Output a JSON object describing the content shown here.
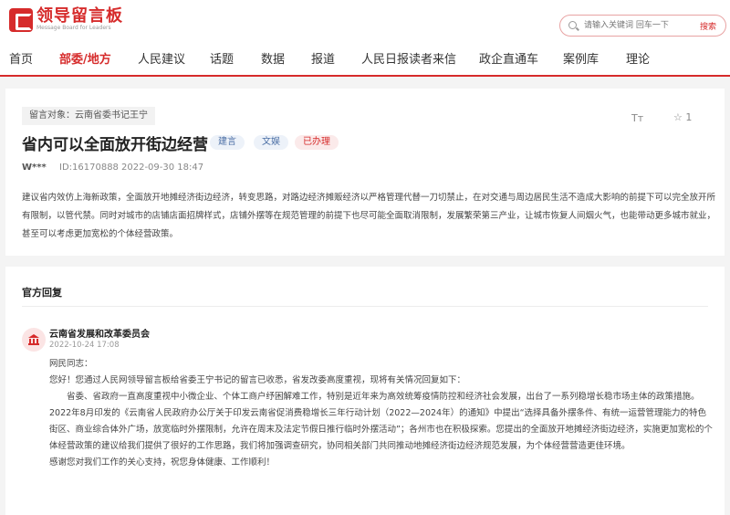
{
  "header": {
    "logo_title": "领导留言板",
    "logo_sub": "Message Board for Leaders",
    "search_placeholder": "请输入关键词 回车一下",
    "search_button": "搜索"
  },
  "nav": {
    "items": [
      "首页",
      "部委/地方",
      "人民建议",
      "话题",
      "数据",
      "报道",
      "人民日报读者来信",
      "政企直通车",
      "案例库",
      "理论"
    ],
    "active_index": 1
  },
  "message": {
    "target": "留言对象：云南省委书记王宁",
    "title": "省内可以全面放开街边经营",
    "tags": [
      "建言",
      "文娱",
      "已办理"
    ],
    "font_toggle": "Tт",
    "star_icon": "☆",
    "star_count": "1",
    "author": "W***",
    "id": "ID:16170888",
    "date": "2022-09-30 18:47",
    "body": "建议省内效仿上海新政策，全面放开地摊经济街边经济，转变思路，对路边经济摊贩经济以严格管理代替一刀切禁止，在对交通与周边居民生活不造成大影响的前提下可以完全放开所有限制，以管代禁。同时对城市的店铺店面招牌样式，店铺外摆等在规范管理的前提下也尽可能全面取消限制，发展繁荣第三产业，让城市恢复人间烟火气，也能带动更多城市就业，甚至可以考虑更加宽松的个体经营政策。"
  },
  "reply": {
    "section_title": "官方回复",
    "org_name": "云南省发展和改革委员会",
    "org_date": "2022-10-24 17:08",
    "paragraphs": [
      "网民同志：",
      "您好！您通过人民网领导留言板给省委王宁书记的留言已收悉，省发改委高度重视，现将有关情况回复如下：",
      "省委、省政府一直高度重视中小微企业、个体工商户纾困解难工作，特别是近年来为高效统筹疫情防控和经济社会发展，出台了一系列稳增长稳市场主体的政策措施。2022年8月印发的《云南省人民政府办公厅关于印发云南省促消费稳增长三年行动计划（2022—2024年）的通知》中提出“选择具备外摆条件、有统一运营管理能力的特色街区、商业综合体外广场，放宽临时外摆限制，允许在周末及法定节假日推行临时外摆活动”；各州市也在积极探索。您提出的全面放开地摊经济街边经济，实施更加宽松的个体经营政策的建议给我们提供了很好的工作思路，我们将加强调查研究，协同相关部门共同推动地摊经济街边经济规范发展，为个体经营营造更佳环境。",
      "感谢您对我们工作的关心支持，祝您身体健康、工作顺利！"
    ]
  },
  "colors": {
    "brand_red": "#d62b2b",
    "tag_blue_bg": "#edf2f9",
    "tag_red_bg": "#fbeaea"
  }
}
